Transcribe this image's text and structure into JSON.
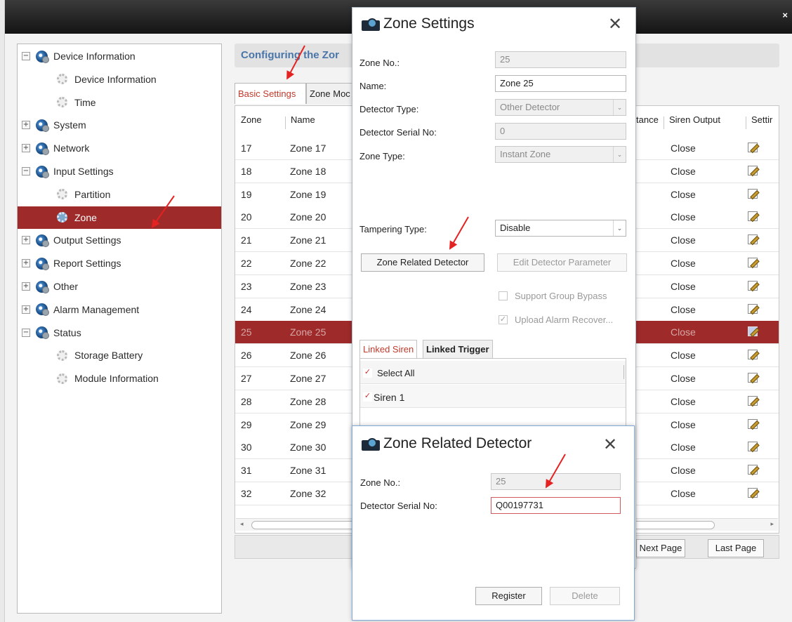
{
  "window": {
    "close_glyph": "×"
  },
  "sidebar": {
    "items": [
      {
        "label": "Device Information",
        "level": 0,
        "toggle": "−"
      },
      {
        "label": "Device Information",
        "level": 1
      },
      {
        "label": "Time",
        "level": 1
      },
      {
        "label": "System",
        "level": 0,
        "toggle": "+"
      },
      {
        "label": "Network",
        "level": 0,
        "toggle": "+"
      },
      {
        "label": "Input Settings",
        "level": 0,
        "toggle": "−"
      },
      {
        "label": "Partition",
        "level": 1
      },
      {
        "label": "Zone",
        "level": 1,
        "selected": true
      },
      {
        "label": "Output Settings",
        "level": 0,
        "toggle": "+"
      },
      {
        "label": "Report Settings",
        "level": 0,
        "toggle": "+"
      },
      {
        "label": "Other",
        "level": 0,
        "toggle": "+"
      },
      {
        "label": "Alarm Management",
        "level": 0,
        "toggle": "+"
      },
      {
        "label": "Status",
        "level": 0,
        "toggle": "−"
      },
      {
        "label": "Storage Battery",
        "level": 1
      },
      {
        "label": "Module Information",
        "level": 1
      }
    ]
  },
  "content": {
    "title": "Configuring the Zor",
    "tabs": [
      "Basic Settings",
      "Zone Moc"
    ],
    "columns": {
      "zone": "Zone",
      "name": "Name",
      "distance": "tance",
      "siren": "Siren Output",
      "settings": "Settir"
    },
    "rows": [
      {
        "zone": "17",
        "name": "Zone 17",
        "siren": "Close"
      },
      {
        "zone": "18",
        "name": "Zone 18",
        "siren": "Close"
      },
      {
        "zone": "19",
        "name": "Zone 19",
        "siren": "Close"
      },
      {
        "zone": "20",
        "name": "Zone 20",
        "siren": "Close"
      },
      {
        "zone": "21",
        "name": "Zone 21",
        "siren": "Close"
      },
      {
        "zone": "22",
        "name": "Zone 22",
        "siren": "Close"
      },
      {
        "zone": "23",
        "name": "Zone 23",
        "siren": "Close"
      },
      {
        "zone": "24",
        "name": "Zone 24",
        "siren": "Close"
      },
      {
        "zone": "25",
        "name": "Zone 25",
        "siren": "Close",
        "selected": true
      },
      {
        "zone": "26",
        "name": "Zone 26",
        "siren": "Close"
      },
      {
        "zone": "27",
        "name": "Zone 27",
        "siren": "Close"
      },
      {
        "zone": "28",
        "name": "Zone 28",
        "siren": "Close"
      },
      {
        "zone": "29",
        "name": "Zone 29",
        "siren": "Close"
      },
      {
        "zone": "30",
        "name": "Zone 30",
        "siren": "Close"
      },
      {
        "zone": "31",
        "name": "Zone 31",
        "siren": "Close"
      },
      {
        "zone": "32",
        "name": "Zone 32",
        "siren": "Close"
      }
    ],
    "pager": {
      "next": "Next Page",
      "last": "Last Page"
    }
  },
  "zone_settings": {
    "title": "Zone Settings",
    "close_glyph": "✕",
    "zone_no_label": "Zone No.:",
    "zone_no_value": "25",
    "name_label": "Name:",
    "name_value": "Zone 25",
    "detector_type_label": "Detector Type:",
    "detector_type_value": "Other Detector",
    "detector_serial_label": "Detector Serial No:",
    "detector_serial_value": "0",
    "zone_type_label": "Zone Type:",
    "zone_type_value": "Instant Zone",
    "tampering_label": "Tampering Type:",
    "tampering_value": "Disable",
    "zone_related_btn": "Zone Related Detector",
    "edit_detector_btn": "Edit Detector Parameter",
    "support_bypass_label": "Support Group Bypass",
    "upload_recover_label": "Upload Alarm Recover...",
    "subtabs": [
      "Linked Siren",
      "Linked Trigger"
    ],
    "select_all_label": "Select All",
    "siren1_label": "Siren 1",
    "check_glyph": "✓",
    "caret_glyph": "⌄"
  },
  "zone_related": {
    "title": "Zone Related Detector",
    "close_glyph": "✕",
    "zone_no_label": "Zone No.:",
    "zone_no_value": "25",
    "serial_label": "Detector Serial No:",
    "serial_value": "Q00197731",
    "register_btn": "Register",
    "delete_btn": "Delete"
  },
  "colors": {
    "accent_red": "#9e2a2a",
    "annotation_red": "#e52222",
    "title_blue": "#4a75a8"
  }
}
